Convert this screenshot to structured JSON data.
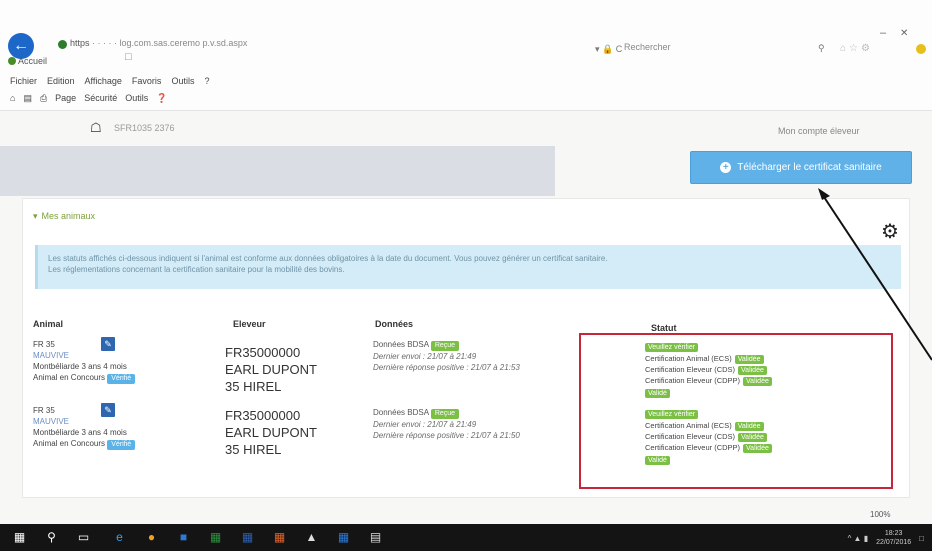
{
  "browser": {
    "url_protocol": "https",
    "url_rest": "· · · · · log.com.sas.ceremo p.v.sd.aspx",
    "tab_title": "Accueil",
    "search_placeholder": "Rechercher",
    "menu": [
      "Fichier",
      "Edition",
      "Affichage",
      "Favoris",
      "Outils",
      "?"
    ],
    "toolbar": [
      "Page",
      "Sécurité",
      "Outils"
    ]
  },
  "header": {
    "farm_code": "SFR1035 2376",
    "my_account": "Mon compte éleveur"
  },
  "download_button": {
    "label": "Télécharger le certificat sanitaire"
  },
  "panel": {
    "title": "Mes animaux",
    "info_line1": "Les statuts affichés ci-dessous indiquent si l'animal est conforme aux données obligatoires à la date du document. Vous pouvez générer un certificat sanitaire.",
    "info_line2": "Les réglementations concernant la certification sanitaire pour la mobilité des bovins.",
    "columns": {
      "animal": "Animal",
      "breeder": "Eleveur",
      "data": "Données",
      "status": "Statut"
    },
    "rows": [
      {
        "animal_id": "FR 35",
        "animal_link": "MAUVIVE",
        "animal_desc": "Montbéliarde 3 ans 4 mois",
        "animal_tag_prefix": "Animal en Concours",
        "animal_tag": "Vérifié",
        "breeder_code": "FR35000000",
        "breeder_name": "EARL DUPONT",
        "breeder_place": "35 HIREL",
        "data_title": "Données BDSA",
        "data_tag": "Reçue",
        "data_line1": "Dernier envoi : 21/07 à 21:49",
        "data_line2": "Dernière réponse positive : 21/07 à 21:53",
        "status_top": "Veuillez vérifier",
        "status_lines": [
          {
            "label": "Certification Animal (ECS)",
            "tag": "Validée"
          },
          {
            "label": "Certification Eleveur (CDS)",
            "tag": "Validée"
          },
          {
            "label": "Certification Eleveur (CDPP)",
            "tag": "Validée"
          }
        ],
        "status_bottom": "Validé"
      },
      {
        "animal_id": "FR 35",
        "animal_link": "MAUVIVE",
        "animal_desc": "Montbéliarde 3 ans 4 mois",
        "animal_tag_prefix": "Animal en Concours",
        "animal_tag": "Vérifié",
        "breeder_code": "FR35000000",
        "breeder_name": "EARL DUPONT",
        "breeder_place": "35 HIREL",
        "data_title": "Données BDSA",
        "data_tag": "Reçue",
        "data_line1": "Dernier envoi : 21/07 à 21:49",
        "data_line2": "Dernière réponse positive : 21/07 à 21:50",
        "status_top": "Veuillez vérifier",
        "status_lines": [
          {
            "label": "Certification Animal (ECS)",
            "tag": "Validée"
          },
          {
            "label": "Certification Eleveur (CDS)",
            "tag": "Validée"
          },
          {
            "label": "Certification Eleveur (CDPP)",
            "tag": "Validée"
          }
        ],
        "status_bottom": "Validé"
      }
    ]
  },
  "zoom": "100%",
  "taskbar": {
    "time": "18:23",
    "date": "22/07/2016"
  }
}
